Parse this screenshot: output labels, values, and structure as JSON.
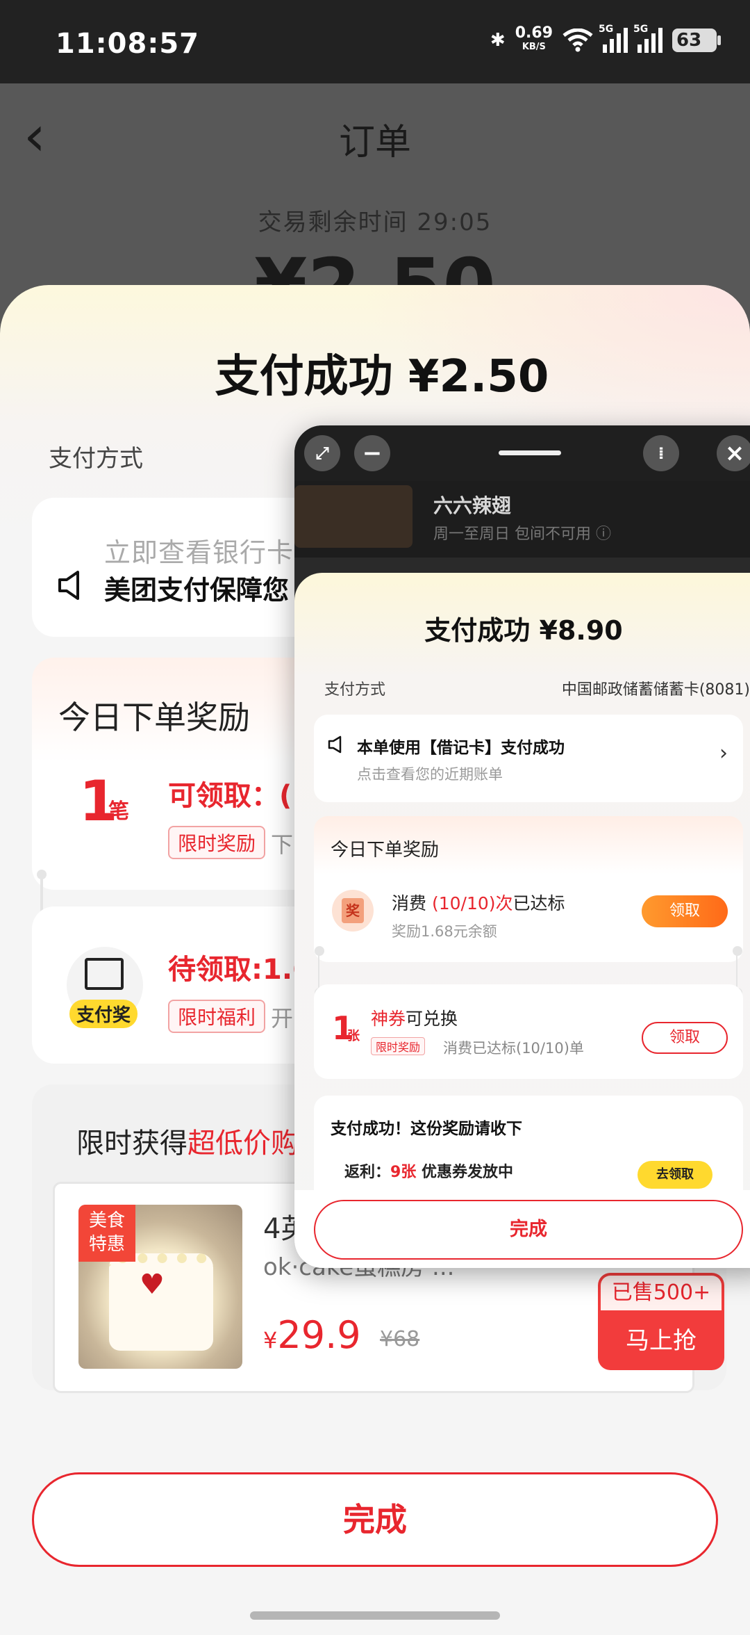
{
  "status_bar": {
    "time": "11:08:57",
    "net_speed": "0.69",
    "net_speed_unit": "KB/S",
    "sim1": "5G",
    "sim2": "5G",
    "battery": "63"
  },
  "background_page": {
    "back_icon": "chevron-left-icon",
    "title": "订单",
    "remaining_time": "交易剩余时间 29:05",
    "amount": "¥2.50"
  },
  "sheet": {
    "title": "支付成功 ¥2.50",
    "pay_method_label": "支付方式",
    "notice": {
      "line1": "立即查看银行卡则",
      "line2": "美团支付保障您",
      "icon": "speaker-icon"
    },
    "reward": {
      "title": "今日下单奖励",
      "count": "1",
      "count_unit": "笔",
      "claimable": "可领取：(",
      "tag": "限时奖励",
      "sub": "下"
    },
    "pay_reward": {
      "badge": "支付奖",
      "pending": "待领取:1.6",
      "tag": "限时福利",
      "sub": "开"
    },
    "promo": {
      "title_prefix": "限时获得",
      "title_highlight": "超低价购",
      "product": {
        "badge_line1": "美食",
        "badge_line2": "特惠",
        "name": "4英",
        "shop": "ok·cake蛋糕房 ...",
        "price_symbol": "¥",
        "price": "29.9",
        "original_price": "¥68",
        "sold": "已售500+",
        "grab_label": "马上抢"
      }
    },
    "done_label": "完成"
  },
  "floating_window": {
    "toolbar": {
      "expand_icon": "expand-icon",
      "minimize_icon": "minimize-icon",
      "voice_icon": "voice-icon",
      "close_icon": "close-icon"
    },
    "behind": {
      "name": "六六辣翅",
      "sub": "周一至周日 包间不可用 ⓘ"
    },
    "title": "支付成功 ¥8.90",
    "pay_method_label": "支付方式",
    "pay_method_value": "中国邮政储蓄储蓄卡(8081)",
    "notice_line1": "本单使用【借记卡】支付成功",
    "notice_line2": "点击查看您的近期账单",
    "reward_title": "今日下单奖励",
    "spend_prefix": "消费",
    "spend_count": "(10/10)次",
    "spend_suffix": "已达标",
    "spend_sub": "奖励1.68元余额",
    "claim_label": "领取",
    "coupon_count": "1",
    "coupon_unit": "张",
    "coupon_title_highlight": "神券",
    "coupon_title_rest": "可兑换",
    "coupon_tag": "限时奖励",
    "coupon_sub": "消费已达标(10/10)单",
    "coupon_claim_label": "领取",
    "success_title": "支付成功！这份奖励请收下",
    "rebate_prefix": "返利：",
    "rebate_count": "9张",
    "rebate_suffix": " 优惠券发放中",
    "go_claim": "去领取",
    "done_label": "完成"
  }
}
